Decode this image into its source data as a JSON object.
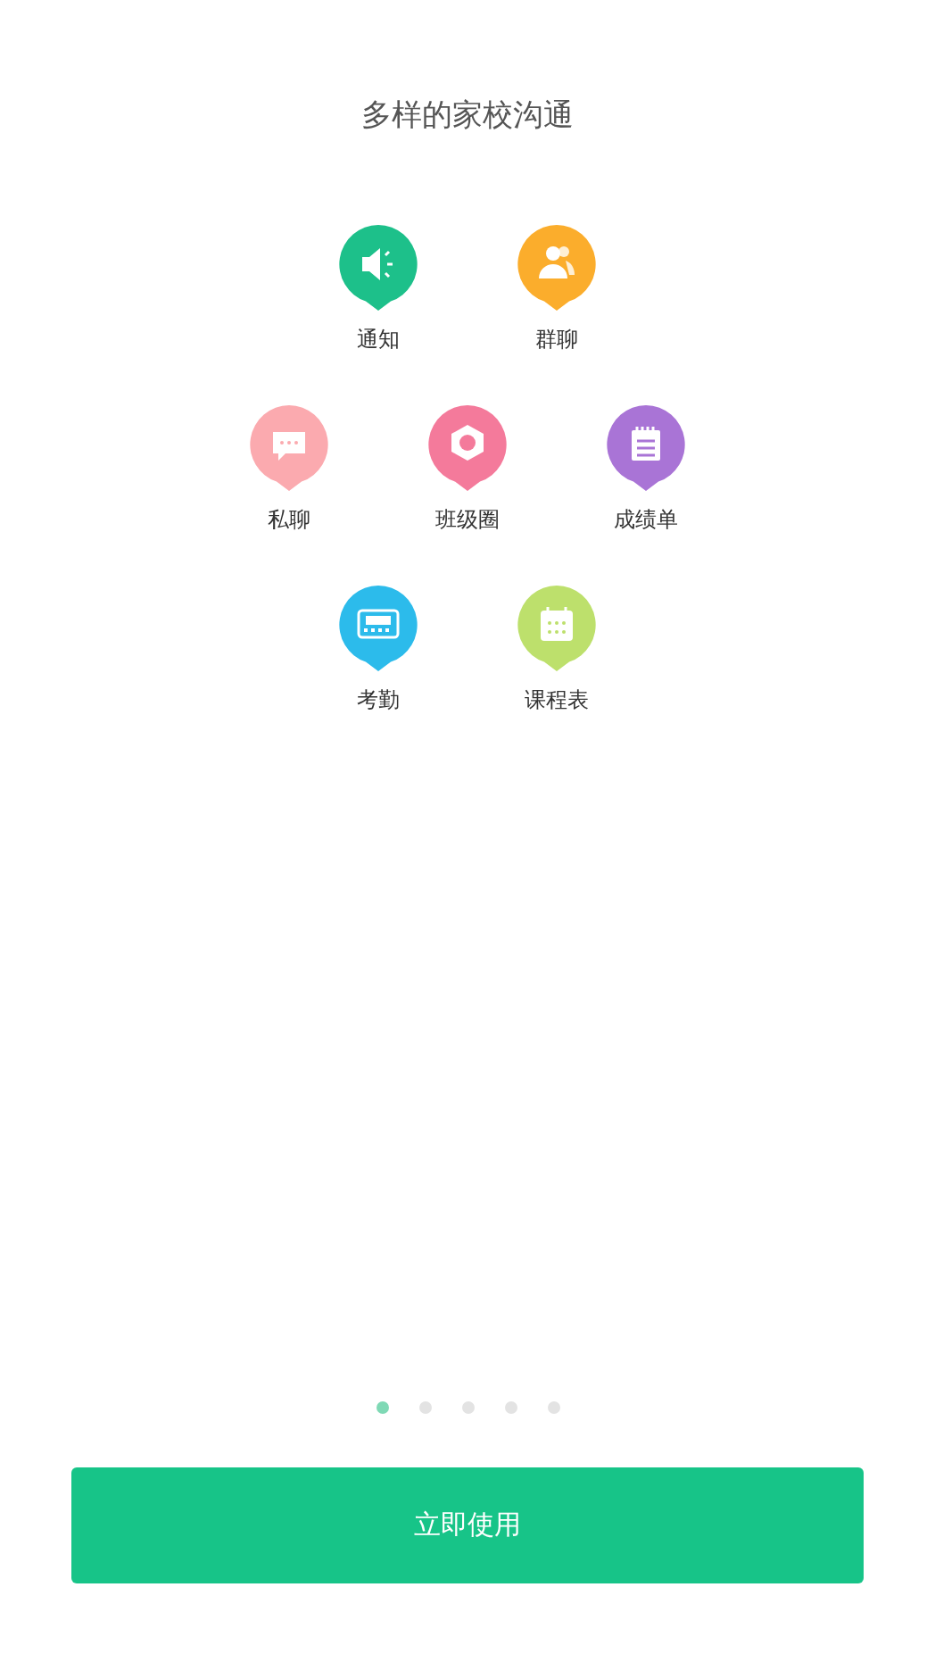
{
  "title": "多样的家校沟通",
  "feature_rows": [
    [
      {
        "label": "通知",
        "kind": "megaphone",
        "color": "#1dc08a"
      },
      {
        "label": "群聊",
        "kind": "people",
        "color": "#fbad2c"
      }
    ],
    [
      {
        "label": "私聊",
        "kind": "chat",
        "color": "#fbaaaf"
      },
      {
        "label": "班级圈",
        "kind": "hexagon",
        "color": "#f47a9b"
      },
      {
        "label": "成绩单",
        "kind": "notepad",
        "color": "#a974d6"
      }
    ],
    [
      {
        "label": "考勤",
        "kind": "clock",
        "color": "#2cbbeb"
      },
      {
        "label": "课程表",
        "kind": "calendar",
        "color": "#bde06c"
      }
    ]
  ],
  "pager": [
    {
      "selected": true
    },
    {
      "selected": false
    },
    {
      "selected": false
    },
    {
      "selected": false
    },
    {
      "selected": false
    }
  ],
  "button": "立即使用"
}
